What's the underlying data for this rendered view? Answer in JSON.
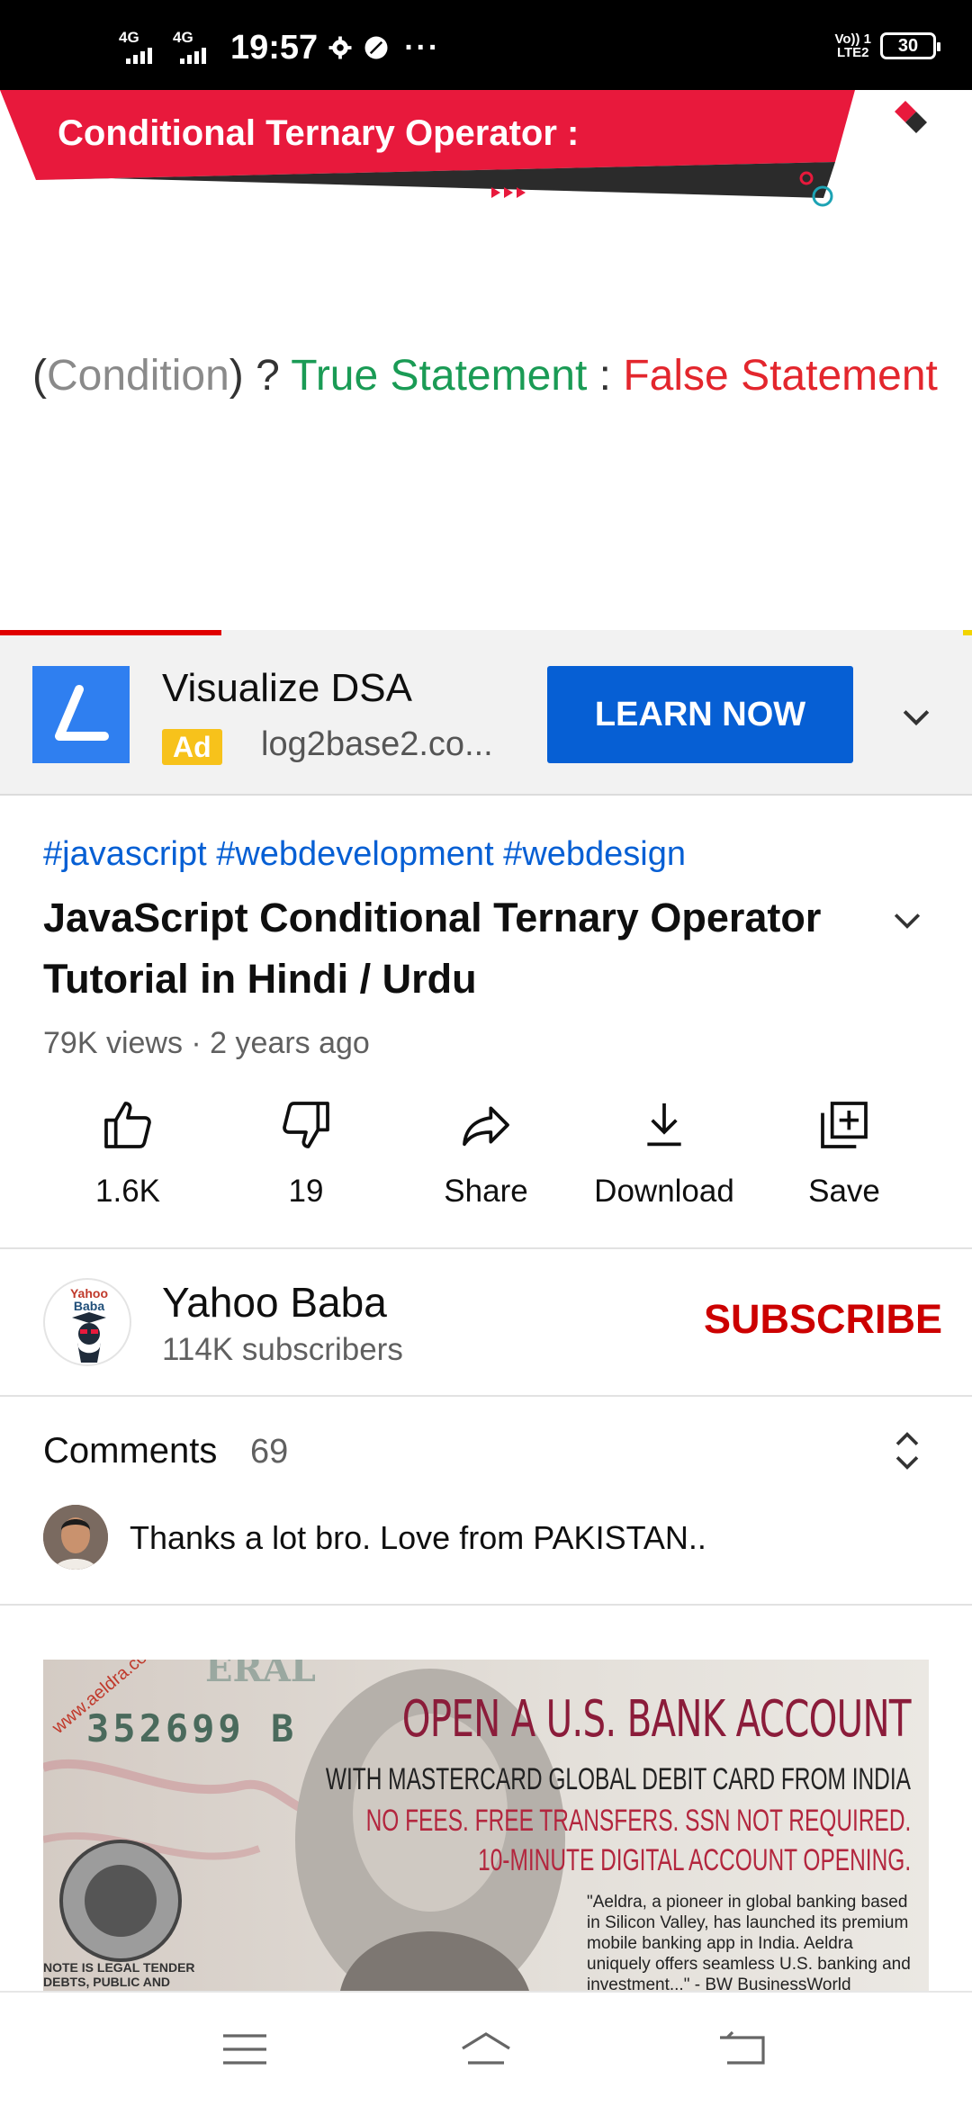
{
  "status_bar": {
    "network_1": "4G",
    "network_2": "4G",
    "time": "19:57",
    "volte_line1": "Vo)) 1",
    "volte_line2": "LTE2",
    "battery": "30",
    "icons": [
      "settings-icon",
      "app-leaf-icon",
      "more-dots-icon"
    ]
  },
  "video": {
    "banner_title": "Conditional Ternary Operator :",
    "formula": {
      "open_paren": "(",
      "condition": "Condition",
      "close_paren_q": ") ?",
      "true_part": "True Statement",
      "colon": ":",
      "false_part": "False Statement"
    },
    "progress": 0.228,
    "colors": {
      "banner": "#e8193c",
      "true": "#1a9b55",
      "false": "#e3262d",
      "progress": "#e00000"
    }
  },
  "ad": {
    "title": "Visualize DSA",
    "badge": "Ad",
    "domain": "log2base2.co...",
    "cta": "LEARN NOW",
    "colors": {
      "cta": "#065fd4",
      "badge": "#f7c21b"
    }
  },
  "info": {
    "hashtags": "#javascript #webdevelopment #webdesign",
    "title": "JavaScript Conditional Ternary Operator Tutorial in Hindi / Urdu",
    "meta": "79K views · 2 years ago"
  },
  "actions": [
    {
      "icon": "thumbs-up-icon",
      "label": "1.6K"
    },
    {
      "icon": "thumbs-down-icon",
      "label": "19"
    },
    {
      "icon": "share-icon",
      "label": "Share"
    },
    {
      "icon": "download-icon",
      "label": "Download"
    },
    {
      "icon": "save-playlist-icon",
      "label": "Save"
    }
  ],
  "channel": {
    "avatar_text_1": "Yahoo",
    "avatar_text_2": "Baba",
    "name": "Yahoo Baba",
    "subscribers": "114K subscribers",
    "subscribe": "SUBSCRIBE"
  },
  "comments": {
    "label": "Comments",
    "count": "69",
    "top_comment": "Thanks a lot bro. Love from PAKISTAN.."
  },
  "promo": {
    "serial": "352699 B",
    "url": "www.aeldra.com",
    "headline": "OPEN A U.S. BANK ACCOUNT",
    "line2": "WITH MASTERCARD GLOBAL DEBIT CARD FROM INDIA",
    "line3": "NO FEES. FREE TRANSFERS. SSN NOT REQUIRED.",
    "line4": "10-MINUTE DIGITAL ACCOUNT OPENING.",
    "quote": "\"Aeldra, a pioneer in global banking based in Silicon Valley, has launched its premium mobile banking app in India. Aeldra uniquely offers seamless U.S. banking and investment...\" - BW BusinessWorld",
    "legal": "NOTE IS LEGAL TENDER DEBTS, PUBLIC AND PRIVATE"
  },
  "nav": {
    "icons": [
      "menu-icon",
      "home-icon",
      "back-icon"
    ]
  }
}
